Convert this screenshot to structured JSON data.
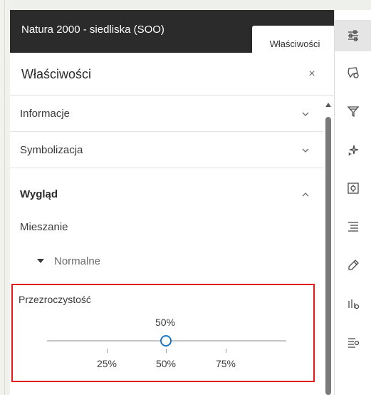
{
  "header": {
    "title": "Natura 2000 - siedliska (SOO)"
  },
  "tooltip": {
    "text": "Właściwości"
  },
  "panel": {
    "title": "Właściwości",
    "close_symbol": "×",
    "sections": [
      {
        "label": "Informacje",
        "state": "collapsed"
      },
      {
        "label": "Symbolizacja",
        "state": "collapsed"
      },
      {
        "label": "Wygląd",
        "state": "expanded"
      }
    ],
    "blending": {
      "label": "Mieszanie",
      "value": "Normalne"
    },
    "transparency": {
      "label": "Przezroczystość",
      "value_label": "50%",
      "value": 0.5,
      "ticks": [
        "25%",
        "50%",
        "75%"
      ]
    }
  },
  "action_bar": [
    {
      "icon": "properties-sliders-icon",
      "active": true
    },
    {
      "icon": "shape-select-icon",
      "active": false
    },
    {
      "icon": "filter-icon",
      "active": false
    },
    {
      "icon": "effects-sparkle-icon",
      "active": false
    },
    {
      "icon": "popup-config-icon",
      "active": false
    },
    {
      "icon": "labels-list-icon",
      "active": false
    },
    {
      "icon": "edit-tag-icon",
      "active": false
    },
    {
      "icon": "chart-settings-icon",
      "active": false
    },
    {
      "icon": "table-settings-icon",
      "active": false
    }
  ],
  "colors": {
    "header_bg": "#2b2b2b",
    "highlight_border": "#e01b1b",
    "slider_accent": "#1a76c2"
  }
}
